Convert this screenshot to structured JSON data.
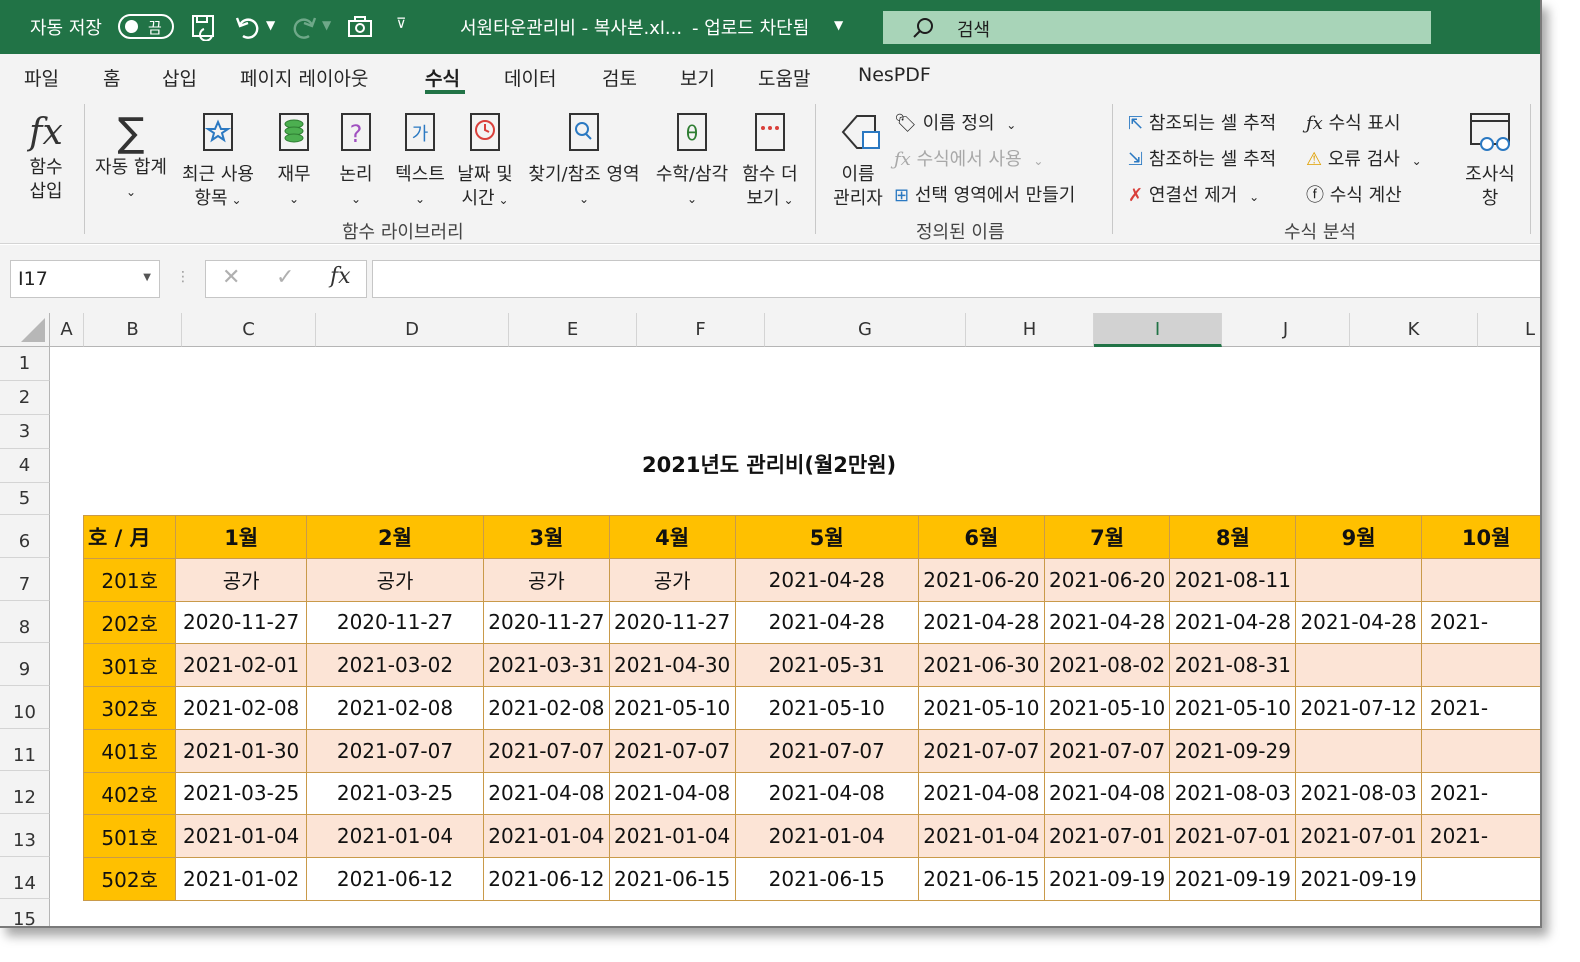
{
  "titlebar": {
    "autosave_label": "자동 저장",
    "autosave_state": "끔",
    "file_title": "서원타운관리비 - 복사본.xl...",
    "status": "- 업로드 차단됨",
    "search_placeholder": "검색"
  },
  "tabs": [
    "파일",
    "홈",
    "삽입",
    "페이지 레이아웃",
    "수식",
    "데이터",
    "검토",
    "보기",
    "도움말",
    "NesPDF"
  ],
  "active_tab": "수식",
  "ribbon": {
    "insert_function": [
      "함수",
      "삽입"
    ],
    "autosum": [
      "자동 합계"
    ],
    "recent": [
      "최근 사용",
      "항목"
    ],
    "financial": [
      "재무"
    ],
    "logical": [
      "논리"
    ],
    "text": [
      "텍스트"
    ],
    "datetime": [
      "날짜 및",
      "시간"
    ],
    "lookup": [
      "찾기/참조 영역"
    ],
    "math": [
      "수학/삼각"
    ],
    "more": [
      "함수 더",
      "보기"
    ],
    "group_library": "함수 라이브러리",
    "name_manager": [
      "이름",
      "관리자"
    ],
    "define_name": "이름 정의",
    "use_in_formula": "수식에서 사용",
    "create_from_selection": "선택 영역에서 만들기",
    "group_names": "정의된 이름",
    "trace_precedents": "참조되는 셀 추적",
    "trace_dependents": "참조하는 셀 추적",
    "remove_arrows": "연결선 제거",
    "show_formulas": "수식 표시",
    "error_checking": "오류 검사",
    "evaluate_formula": "수식 계산",
    "group_audit": "수식 분석",
    "watch_window": [
      "조사식",
      "창"
    ]
  },
  "formula_bar": {
    "name_box": "I17",
    "fx": "fx",
    "value": ""
  },
  "columns": [
    "A",
    "B",
    "C",
    "D",
    "E",
    "F",
    "G",
    "H",
    "I",
    "J",
    "K",
    "L"
  ],
  "selected_column": "I",
  "rows": [
    "1",
    "2",
    "3",
    "4",
    "5",
    "6",
    "7",
    "8",
    "9",
    "10",
    "11",
    "12",
    "13",
    "14",
    "15"
  ],
  "sheet": {
    "title": "2021년도 관리비(월2만원)",
    "header": [
      "호 / 月",
      "1월",
      "2월",
      "3월",
      "4월",
      "5월",
      "6월",
      "7월",
      "8월",
      "9월",
      "10월"
    ],
    "units": [
      {
        "unit": "201호",
        "values": [
          "공가",
          "공가",
          "공가",
          "공가",
          "2021-04-28",
          "2021-06-20",
          "2021-06-20",
          "2021-08-11",
          "",
          ""
        ]
      },
      {
        "unit": "202호",
        "values": [
          "2020-11-27",
          "2020-11-27",
          "2020-11-27",
          "2020-11-27",
          "2021-04-28",
          "2021-04-28",
          "2021-04-28",
          "2021-04-28",
          "2021-04-28",
          "2021-"
        ]
      },
      {
        "unit": "301호",
        "values": [
          "2021-02-01",
          "2021-03-02",
          "2021-03-31",
          "2021-04-30",
          "2021-05-31",
          "2021-06-30",
          "2021-08-02",
          "2021-08-31",
          "",
          ""
        ]
      },
      {
        "unit": "302호",
        "values": [
          "2021-02-08",
          "2021-02-08",
          "2021-02-08",
          "2021-05-10",
          "2021-05-10",
          "2021-05-10",
          "2021-05-10",
          "2021-05-10",
          "2021-07-12",
          "2021-"
        ]
      },
      {
        "unit": "401호",
        "values": [
          "2021-01-30",
          "2021-07-07",
          "2021-07-07",
          "2021-07-07",
          "2021-07-07",
          "2021-07-07",
          "2021-07-07",
          "2021-09-29",
          "",
          ""
        ]
      },
      {
        "unit": "402호",
        "values": [
          "2021-03-25",
          "2021-03-25",
          "2021-04-08",
          "2021-04-08",
          "2021-04-08",
          "2021-04-08",
          "2021-04-08",
          "2021-08-03",
          "2021-08-03",
          "2021-"
        ]
      },
      {
        "unit": "501호",
        "values": [
          "2021-01-04",
          "2021-01-04",
          "2021-01-04",
          "2021-01-04",
          "2021-01-04",
          "2021-01-04",
          "2021-07-01",
          "2021-07-01",
          "2021-07-01",
          "2021-"
        ]
      },
      {
        "unit": "502호",
        "values": [
          "2021-01-02",
          "2021-06-12",
          "2021-06-12",
          "2021-06-15",
          "2021-06-15",
          "2021-06-15",
          "2021-09-19",
          "2021-09-19",
          "2021-09-19",
          ""
        ]
      }
    ]
  },
  "colors": {
    "excel_green": "#217346",
    "header_fill": "#ffc000",
    "alt_row_fill": "#fce4d6"
  }
}
